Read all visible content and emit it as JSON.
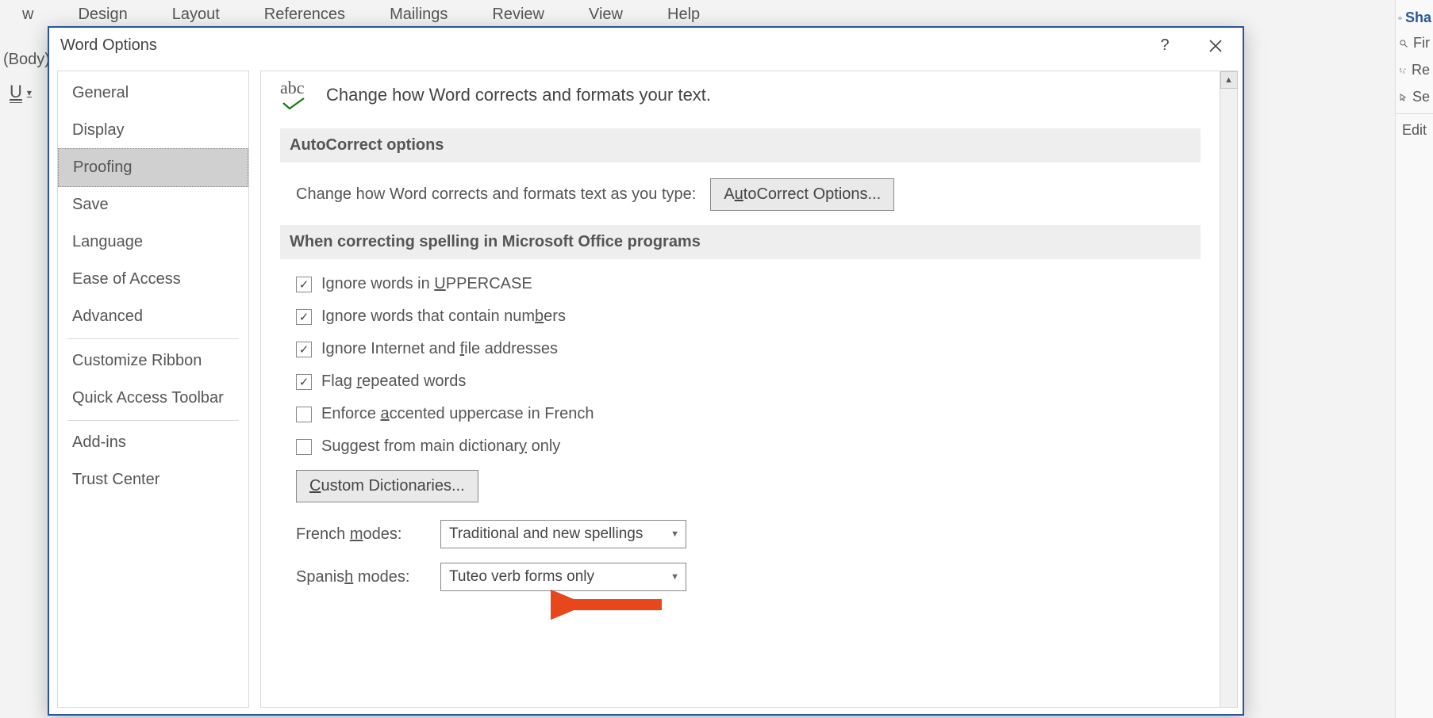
{
  "bg_menu": [
    "w",
    "Design",
    "Layout",
    "References",
    "Mailings",
    "Review",
    "View",
    "Help"
  ],
  "bg_left": {
    "body": "(Body)",
    "u": "U"
  },
  "bg_right": {
    "share": "Sha",
    "items": [
      "Fir",
      "Re",
      "Se",
      "Edit"
    ]
  },
  "dialog": {
    "title": "Word Options",
    "nav": {
      "group1": [
        "General",
        "Display",
        "Proofing",
        "Save",
        "Language",
        "Ease of Access",
        "Advanced"
      ],
      "group2": [
        "Customize Ribbon",
        "Quick Access Toolbar"
      ],
      "group3": [
        "Add-ins",
        "Trust Center"
      ],
      "selected": "Proofing"
    },
    "header": {
      "abc": "abc",
      "title": "Change how Word corrects and formats your text."
    },
    "section1": {
      "head": "AutoCorrect options",
      "row_label": "Change how Word corrects and formats text as you type:",
      "btn_pre": "A",
      "btn_u": "u",
      "btn_post": "toCorrect Options..."
    },
    "section2": {
      "head": "When correcting spelling in Microsoft Office programs",
      "chk1_pre": "Ignore words in ",
      "chk1_u": "U",
      "chk1_post": "PPERCASE",
      "chk2_pre": "Ignore words that contain num",
      "chk2_u": "b",
      "chk2_post": "ers",
      "chk3_pre": "Ignore Internet and ",
      "chk3_u": "f",
      "chk3_post": "ile addresses",
      "chk4_pre": "Flag ",
      "chk4_u": "r",
      "chk4_post": "epeated words",
      "chk5_pre": "Enforce ",
      "chk5_u": "a",
      "chk5_post": "ccented uppercase in French",
      "chk6_pre": "Suggest from main dictionar",
      "chk6_u": "y",
      "chk6_post": " only",
      "custom_btn_u": "C",
      "custom_btn_post": "ustom Dictionaries...",
      "french_label_pre": "French ",
      "french_label_u": "m",
      "french_label_post": "odes:",
      "french_value": "Traditional and new spellings",
      "spanish_label_pre": "Spanis",
      "spanish_label_u": "h",
      "spanish_label_post": " modes:",
      "spanish_value": "Tuteo verb forms only",
      "checks": {
        "c1": true,
        "c2": true,
        "c3": true,
        "c4": true,
        "c5": false,
        "c6": false
      }
    }
  }
}
